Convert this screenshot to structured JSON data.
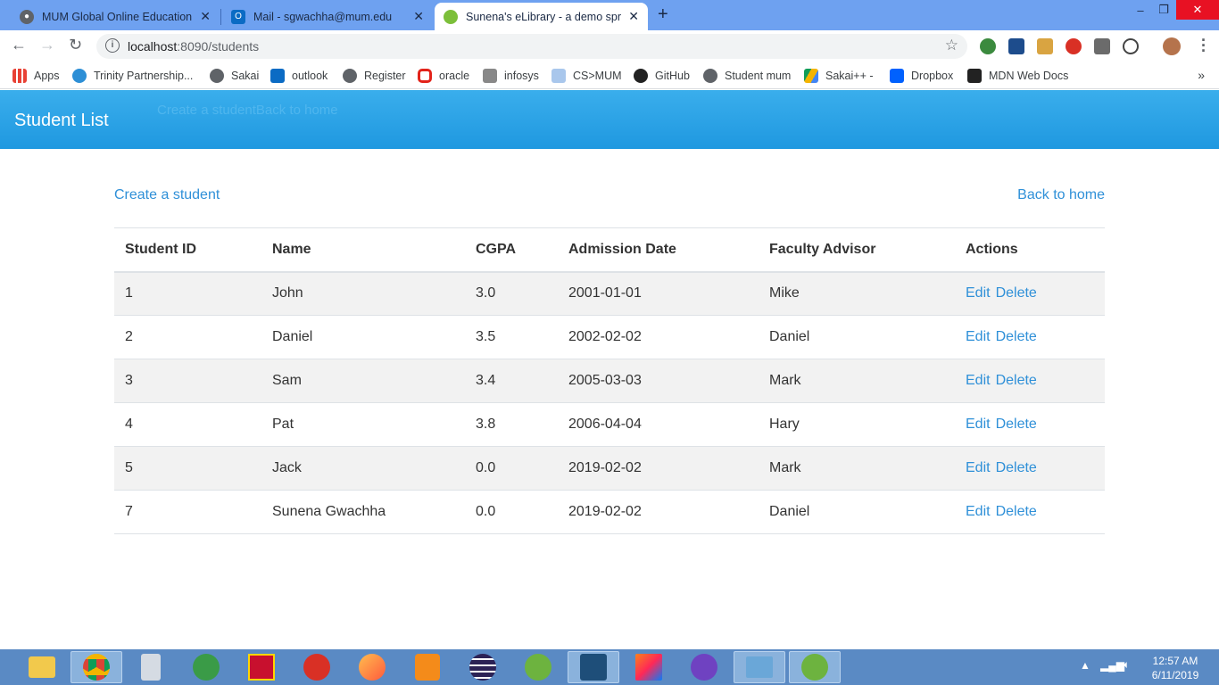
{
  "browser": {
    "tabs": [
      {
        "title": "MUM Global Online Education : C",
        "active": false
      },
      {
        "title": "Mail - sgwachha@mum.edu",
        "active": false
      },
      {
        "title": "Sunena's eLibrary - a demo sprin",
        "active": true
      }
    ],
    "url_host": "localhost",
    "url_path": ":8090/students",
    "bookmarks": [
      "Apps",
      "Trinity Partnership...",
      "Sakai",
      "outlook",
      "Register",
      "oracle",
      "infosys",
      "CS>MUM",
      "GitHub",
      "Student mum",
      "Sakai++ -",
      "Dropbox",
      "MDN Web Docs"
    ]
  },
  "header": {
    "title": "Student List",
    "ghost_text": "Create a studentBack to home"
  },
  "links": {
    "create": "Create a student",
    "home": "Back to home"
  },
  "table": {
    "columns": [
      "Student ID",
      "Name",
      "CGPA",
      "Admission Date",
      "Faculty Advisor",
      "Actions"
    ],
    "rows": [
      {
        "id": "1",
        "name": "John",
        "cgpa": "3.0",
        "date": "2001-01-01",
        "advisor": "Mike"
      },
      {
        "id": "2",
        "name": "Daniel",
        "cgpa": "3.5",
        "date": "2002-02-02",
        "advisor": "Daniel"
      },
      {
        "id": "3",
        "name": "Sam",
        "cgpa": "3.4",
        "date": "2005-03-03",
        "advisor": "Mark"
      },
      {
        "id": "4",
        "name": "Pat",
        "cgpa": "3.8",
        "date": "2006-04-04",
        "advisor": "Hary"
      },
      {
        "id": "5",
        "name": "Jack",
        "cgpa": "0.0",
        "date": "2019-02-02",
        "advisor": "Mark"
      },
      {
        "id": "7",
        "name": "Sunena Gwachha",
        "cgpa": "0.0",
        "date": "2019-02-02",
        "advisor": "Daniel"
      }
    ],
    "edit_label": "Edit",
    "delete_label": "Delete"
  },
  "taskbar": {
    "time": "12:57 AM",
    "date": "6/11/2019"
  },
  "colors": {
    "header": "#2ba3e6",
    "link": "#2f90d8",
    "tabstrip": "#6ea1f0",
    "taskbar": "#5a8ac4"
  }
}
